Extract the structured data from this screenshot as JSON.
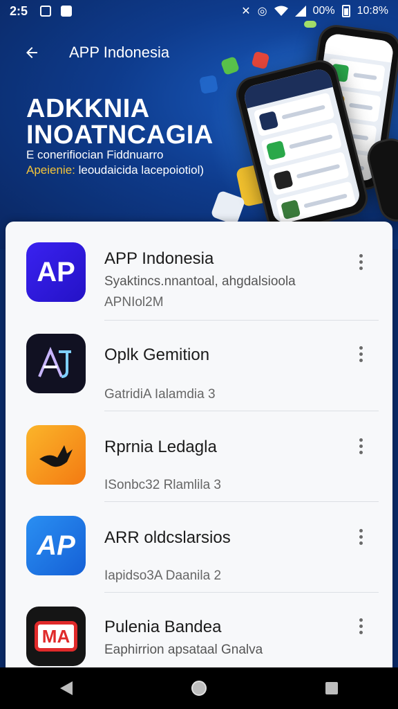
{
  "status_bar": {
    "time": "2:5",
    "battery_text": "00%",
    "clock": "10:8%"
  },
  "topbar": {
    "title": "APP Indonesia"
  },
  "hero": {
    "title_line1": "ADKKNIA",
    "title_line2": "INOATNCAGIA",
    "subtitle_line1": "E conerifiocian Fiddnuarro",
    "subtitle_accent": "Apeienie:",
    "subtitle_line2_rest": " leoudaicida  lacepoiotiol)"
  },
  "apps": [
    {
      "icon_text": "AP",
      "icon_bg": "#2f1fe0",
      "name": "APP Indonesia",
      "desc": "Syaktincs.nnantoal, ahgdalsioola",
      "meta": "APNIol2M"
    },
    {
      "icon_text": "AJ",
      "icon_bg": "#111122",
      "name": "Oplk Gemition",
      "desc": "",
      "meta": "GatridiA   Ialamdia 3"
    },
    {
      "icon_text": "",
      "icon_bg": "#f7a11a",
      "name": "Rprnia Ledagla",
      "desc": "",
      "meta": "ISonbc32  Rlamlila 3"
    },
    {
      "icon_text": "AP",
      "icon_bg": "#1e7fe8",
      "name": "ARR oldcslarsios",
      "desc": "",
      "meta": "Iapidso3A  Daanila 2"
    },
    {
      "icon_text": "MA",
      "icon_bg": "#151515",
      "name": "Pulenia Bandea",
      "desc": "Eaphirrion apsataal  Gnalva",
      "meta": ""
    }
  ],
  "colors": {
    "header_blue": "#0e3b8c",
    "accent_yellow": "#f4c43a"
  }
}
